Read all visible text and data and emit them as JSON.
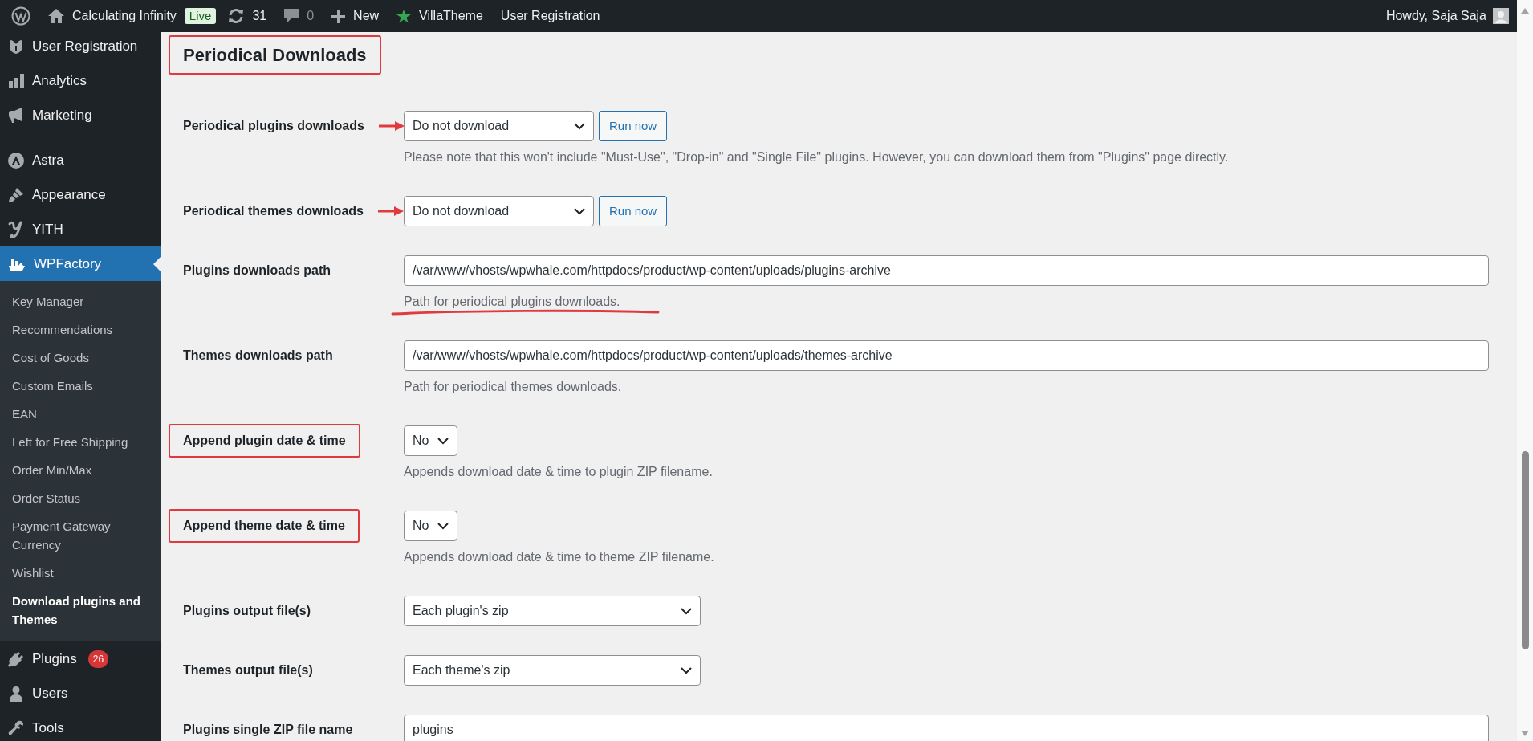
{
  "admin_bar": {
    "site_name": "Calculating Infinity",
    "site_badge": "Live",
    "updates_count": "31",
    "comments_count": "0",
    "new_label": "New",
    "links": [
      "VillaTheme",
      "User Registration"
    ],
    "greeting": "Howdy, Saja Saja"
  },
  "sidebar": {
    "groups": [
      {
        "items": [
          {
            "label": "User Registration",
            "selected": false
          },
          {
            "label": "Analytics",
            "selected": false
          },
          {
            "label": "Marketing",
            "selected": false
          }
        ]
      },
      {
        "items": [
          {
            "label": "Astra",
            "selected": false
          },
          {
            "label": "Appearance",
            "selected": false
          },
          {
            "label": "YITH",
            "selected": false
          },
          {
            "label": "WPFactory",
            "selected": true,
            "children": [
              {
                "label": "Key Manager",
                "selected": false
              },
              {
                "label": "Recommendations",
                "selected": false
              },
              {
                "label": "Cost of Goods",
                "selected": false
              },
              {
                "label": "Custom Emails",
                "selected": false
              },
              {
                "label": "EAN",
                "selected": false
              },
              {
                "label": "Left for Free Shipping",
                "selected": false
              },
              {
                "label": "Order Min/Max",
                "selected": false
              },
              {
                "label": "Order Status",
                "selected": false
              },
              {
                "label": "Payment Gateway Currency",
                "selected": false
              },
              {
                "label": "Wishlist",
                "selected": false
              },
              {
                "label": "Download plugins and Themes",
                "selected": true
              }
            ]
          },
          {
            "label": "Plugins",
            "selected": false,
            "badge": "26"
          },
          {
            "label": "Users",
            "selected": false
          },
          {
            "label": "Tools",
            "selected": false
          }
        ]
      }
    ]
  },
  "section_title": {
    "text": "Periodical Downloads",
    "highlighted": true
  },
  "fields": [
    {
      "label": "Periodical plugins downloads",
      "kind": "select",
      "value": "Do not download",
      "button": "Run now",
      "description": "Please note that this won't include \"Must-Use\", \"Drop-in\" and \"Single File\" plugins. However, you can download them from \"Plugins\" page directly.",
      "highlighted": false,
      "arrow": true,
      "description_underlined": false
    },
    {
      "label": "Periodical themes downloads",
      "kind": "select",
      "value": "Do not download",
      "button": "Run now",
      "highlighted": false,
      "arrow": true
    },
    {
      "label": "Plugins downloads path",
      "kind": "text",
      "value": "/var/www/vhosts/wpwhale.com/httpdocs/product/wp-content/uploads/plugins-archive",
      "description": "Path for periodical plugins downloads.",
      "highlighted": false,
      "arrow": false,
      "description_underlined": true
    },
    {
      "label": "Themes downloads path",
      "kind": "text",
      "value": "/var/www/vhosts/wpwhale.com/httpdocs/product/wp-content/uploads/themes-archive",
      "description": "Path for periodical themes downloads.",
      "highlighted": false,
      "arrow": false,
      "description_underlined": false
    },
    {
      "label": "Append plugin date & time",
      "kind": "short_select",
      "value": "No",
      "description": "Appends download date & time to plugin ZIP filename.",
      "highlighted": true,
      "arrow": false,
      "description_underlined": false
    },
    {
      "label": "Append theme date & time",
      "kind": "short_select",
      "value": "No",
      "description": "Appends download date & time to theme ZIP filename.",
      "highlighted": true,
      "arrow": false,
      "description_underlined": false
    },
    {
      "label": "Plugins output file(s)",
      "kind": "wide_select",
      "value": "Each plugin's zip",
      "highlighted": false,
      "arrow": false
    },
    {
      "label": "Themes output file(s)",
      "kind": "wide_select",
      "value": "Each theme's zip",
      "highlighted": false,
      "arrow": false
    },
    {
      "label": "Plugins single ZIP file name",
      "kind": "text",
      "value": "plugins",
      "highlighted": false,
      "arrow": false
    }
  ]
}
